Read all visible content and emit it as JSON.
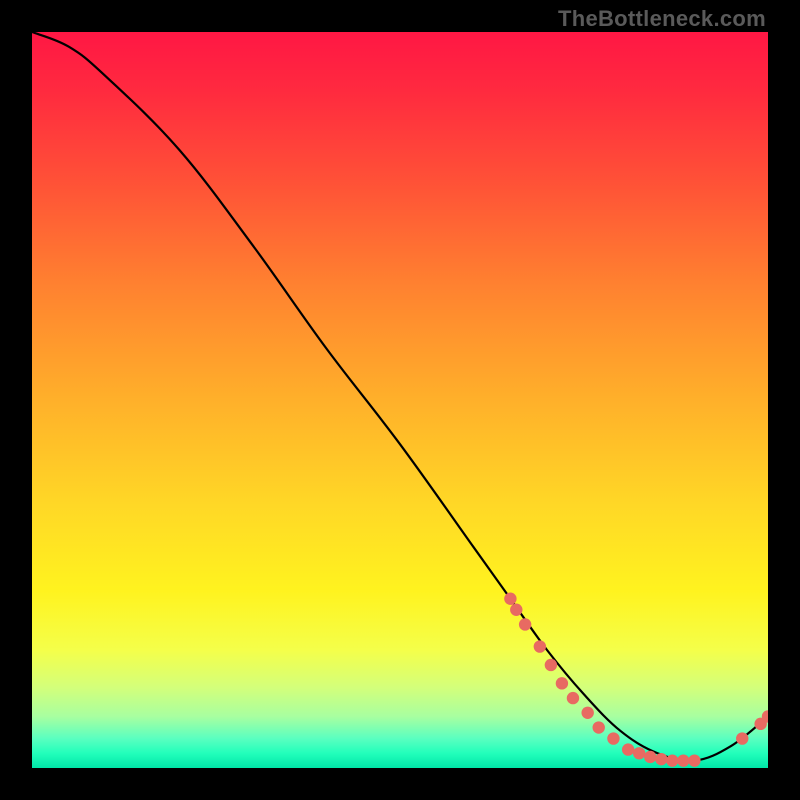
{
  "attribution": "TheBottleneck.com",
  "chart_data": {
    "type": "line",
    "title": "",
    "xlabel": "",
    "ylabel": "",
    "xlim": [
      0,
      100
    ],
    "ylim": [
      0,
      100
    ],
    "series": [
      {
        "name": "bottleneck-curve",
        "x": [
          0,
          5,
          10,
          20,
          30,
          40,
          50,
          60,
          65,
          70,
          75,
          80,
          85,
          90,
          95,
          100
        ],
        "y": [
          100,
          98,
          94,
          84,
          71,
          57,
          44,
          30,
          23,
          16,
          10,
          5,
          2,
          1,
          3,
          7
        ]
      }
    ],
    "markers": [
      {
        "name": "point",
        "x": 65.0,
        "y": 23.0
      },
      {
        "name": "point",
        "x": 65.8,
        "y": 21.5
      },
      {
        "name": "point",
        "x": 67.0,
        "y": 19.5
      },
      {
        "name": "point",
        "x": 69.0,
        "y": 16.5
      },
      {
        "name": "point",
        "x": 70.5,
        "y": 14.0
      },
      {
        "name": "point",
        "x": 72.0,
        "y": 11.5
      },
      {
        "name": "point",
        "x": 73.5,
        "y": 9.5
      },
      {
        "name": "point",
        "x": 75.5,
        "y": 7.5
      },
      {
        "name": "point",
        "x": 77.0,
        "y": 5.5
      },
      {
        "name": "point",
        "x": 79.0,
        "y": 4.0
      },
      {
        "name": "point",
        "x": 81.0,
        "y": 2.5
      },
      {
        "name": "point",
        "x": 82.5,
        "y": 2.0
      },
      {
        "name": "point",
        "x": 84.0,
        "y": 1.5
      },
      {
        "name": "point",
        "x": 85.5,
        "y": 1.2
      },
      {
        "name": "point",
        "x": 87.0,
        "y": 1.0
      },
      {
        "name": "point",
        "x": 88.5,
        "y": 1.0
      },
      {
        "name": "point",
        "x": 90.0,
        "y": 1.0
      },
      {
        "name": "point",
        "x": 96.5,
        "y": 4.0
      },
      {
        "name": "point",
        "x": 99.0,
        "y": 6.0
      },
      {
        "name": "point",
        "x": 100.0,
        "y": 7.0
      }
    ],
    "colors": {
      "curve": "#000000",
      "marker": "#e86a62"
    }
  }
}
